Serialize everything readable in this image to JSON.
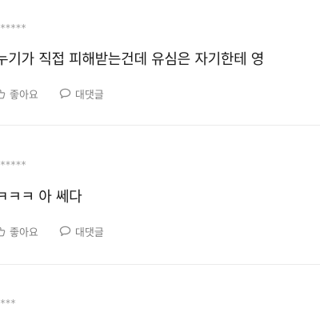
{
  "comments": [
    {
      "author_masked": "******",
      "text": "누기가 직접 피해받는건데 유심은 자기한테 영",
      "like_label": "좋아요",
      "reply_label": "대댓글"
    },
    {
      "author_masked": "******",
      "text": "ㅋㅋㅋ 아 쎄다",
      "like_label": "좋아요",
      "reply_label": "대댓글"
    },
    {
      "author_masked": "****"
    }
  ],
  "icons": {
    "like": "thumbs-up-icon",
    "reply": "speech-bubble-icon"
  }
}
